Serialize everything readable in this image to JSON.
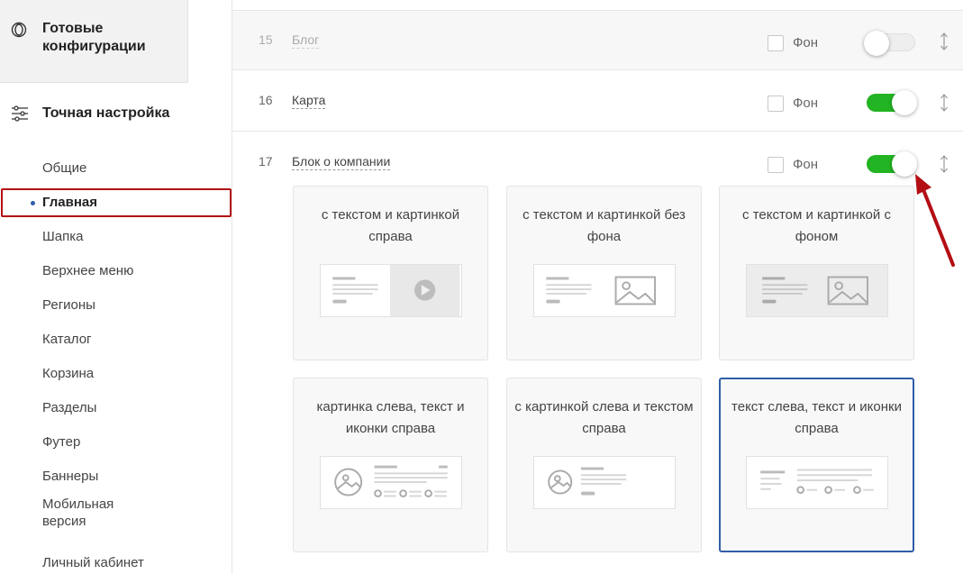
{
  "sidebar": {
    "ready_title": "Готовые конфигурации",
    "fine_title": "Точная настройка",
    "items": [
      {
        "label": "Общие"
      },
      {
        "label": "Главная"
      },
      {
        "label": "Шапка"
      },
      {
        "label": "Верхнее меню"
      },
      {
        "label": "Регионы"
      },
      {
        "label": "Каталог"
      },
      {
        "label": "Корзина"
      },
      {
        "label": "Разделы"
      },
      {
        "label": "Футер"
      },
      {
        "label": "Баннеры"
      },
      {
        "label": "Мобильная версия"
      },
      {
        "label": "Личный кабинет"
      }
    ],
    "active_item": "Главная"
  },
  "rows": [
    {
      "num": "15",
      "name": "Блог",
      "fon_label": "Фон",
      "fon_checked": false,
      "enabled": false
    },
    {
      "num": "16",
      "name": "Карта",
      "fon_label": "Фон",
      "fon_checked": false,
      "enabled": true
    },
    {
      "num": "17",
      "name": "Блок о компании",
      "fon_label": "Фон",
      "fon_checked": false,
      "enabled": true
    }
  ],
  "variants": [
    {
      "label": "с текстом и картинкой справа",
      "preview": "text-video"
    },
    {
      "label": "с текстом и картинкой без фона",
      "preview": "text-image"
    },
    {
      "label": "с текстом и картинкой с фоном",
      "preview": "text-image-bg"
    },
    {
      "label": "картинка слева, текст и иконки справа",
      "preview": "image-text-icons"
    },
    {
      "label": "с картинкой слева и текстом справа",
      "preview": "image-text"
    },
    {
      "label": "текст слева, текст и иконки справа",
      "preview": "text-text-icons",
      "selected": true
    }
  ],
  "colors": {
    "toggle_on": "#22b422",
    "selected_border": "#2f5ea8",
    "highlight": "#b30e14",
    "arrow": "#b30e14"
  }
}
